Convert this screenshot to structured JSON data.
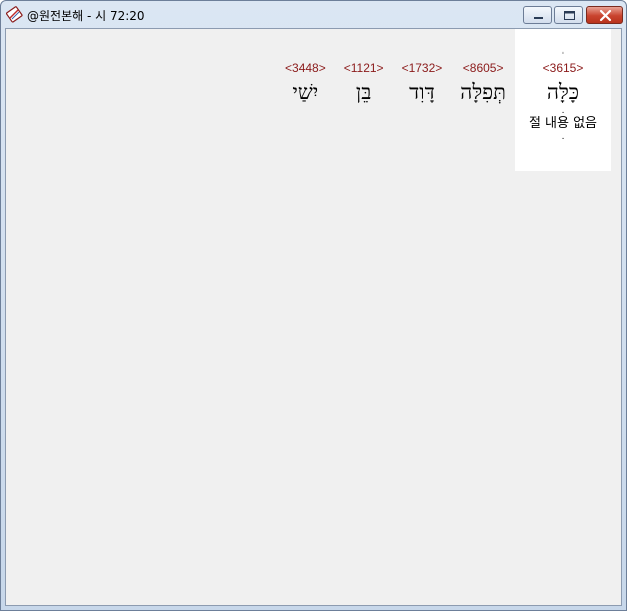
{
  "window": {
    "title": "@원전본해 - 시 72:20"
  },
  "words": [
    {
      "strong": "<3615>",
      "hebrew": "כָּלָּה",
      "gloss": "절 내용 없음",
      "selected": true
    },
    {
      "strong": "<8605>",
      "hebrew": "תְּפִלָּה",
      "gloss": "",
      "selected": false
    },
    {
      "strong": "<1732>",
      "hebrew": "דָּוִד",
      "gloss": "",
      "selected": false
    },
    {
      "strong": "<1121>",
      "hebrew": "בֵּן",
      "gloss": "",
      "selected": false
    },
    {
      "strong": "<3448>",
      "hebrew": "יִשַׁי",
      "gloss": "",
      "selected": false
    }
  ],
  "icons": {
    "app": "bible-book-icon",
    "minimize": "minimize-icon",
    "maximize": "maximize-icon",
    "close": "close-icon"
  },
  "colors": {
    "strong_number": "#8b1a1a",
    "close_button": "#c9442f",
    "client_bg": "#f0f0f0",
    "selected_bg": "#ffffff"
  }
}
